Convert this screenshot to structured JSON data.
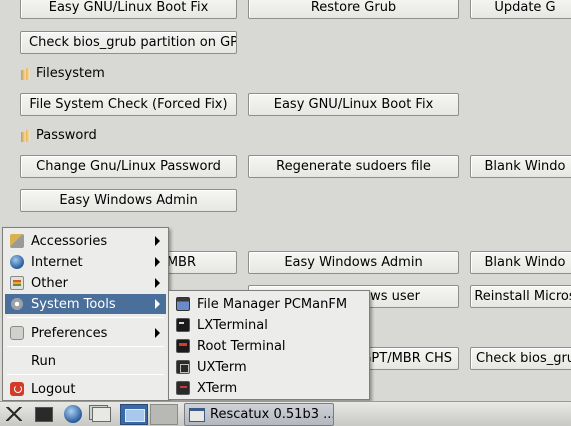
{
  "rows": {
    "r0": [
      "Easy GNU/Linux Boot Fix",
      "Restore Grub",
      "Update G"
    ],
    "r1": [
      "Check bios_grub partition on GPT"
    ],
    "r2": [
      "File System Check (Forced Fix)",
      "Easy GNU/Linux Boot Fix"
    ],
    "r3": [
      "Change Gnu/Linux Password",
      "Regenerate sudoers file",
      "Blank Windo"
    ],
    "r4": [
      "Easy Windows Admin"
    ],
    "r5": [
      "MBR",
      "Easy Windows Admin",
      "Blank Windo"
    ],
    "r6": [
      "ws user",
      "Reinstall Micros"
    ],
    "r7": [
      "GPT/MBR CHS",
      "Check bios_gru"
    ]
  },
  "sections": {
    "filesystem": "Filesystem",
    "password": "Password"
  },
  "main_menu": {
    "items": [
      "Accessories",
      "Internet",
      "Other",
      "System Tools",
      "Preferences",
      "Run",
      "Logout"
    ],
    "active": "System Tools"
  },
  "submenu": {
    "items": [
      "File Manager PCManFM",
      "LXTerminal",
      "Root Terminal",
      "UXTerm",
      "XTerm"
    ]
  },
  "taskbar": {
    "task_label": "Rescatux 0.51b3 ..."
  },
  "colors": {
    "background": "#d8d8d4",
    "menu_highlight": "#4a6f9a",
    "pager_active": "#3a6aa8"
  }
}
